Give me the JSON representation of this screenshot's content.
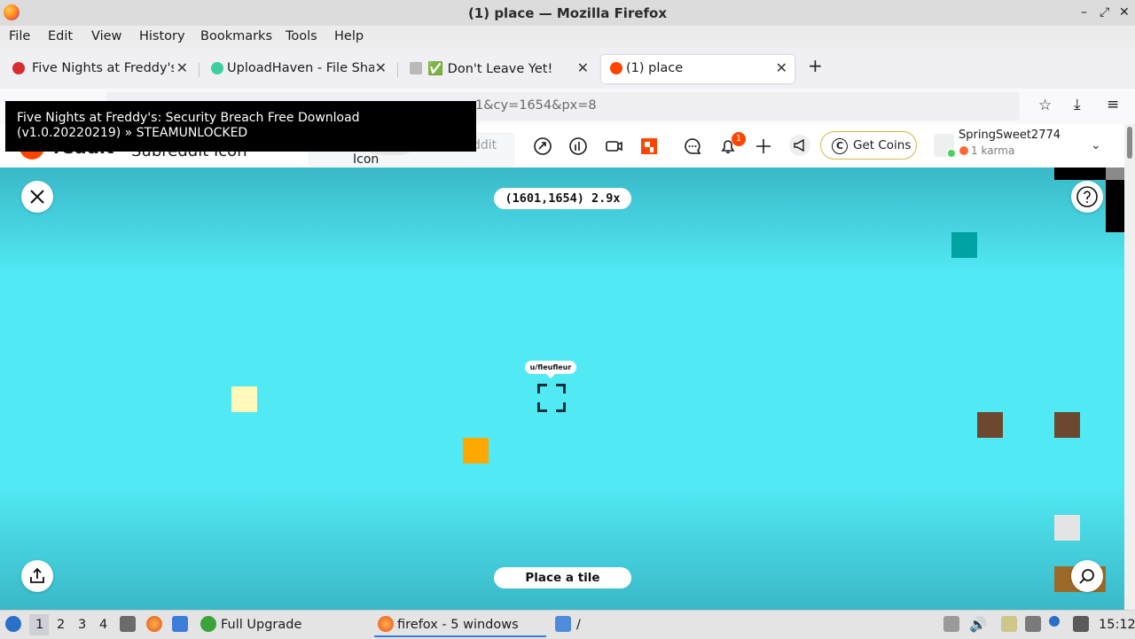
{
  "window": {
    "title": "(1) place — Mozilla Firefox",
    "controls": {
      "minimize": "–",
      "restore": "⤢",
      "close": "✕"
    }
  },
  "menu": {
    "items": [
      "File",
      "Edit",
      "View",
      "History",
      "Bookmarks",
      "Tools",
      "Help"
    ]
  },
  "tabs": [
    {
      "label": "Five Nights at Freddy's: ",
      "icon": "fnaf-icon",
      "active": false
    },
    {
      "label": "UploadHaven - File Sharin",
      "icon": "uploadhaven-cloud-icon",
      "active": false
    },
    {
      "label": "✅ Don't Leave Yet!",
      "icon": "generic-page-icon",
      "active": false
    },
    {
      "label": "(1) place",
      "icon": "reddit-icon",
      "active": true
    }
  ],
  "newtab": "+",
  "urlbar": {
    "visible_text": "1&cy=1654&px=8"
  },
  "tooltip": {
    "text": "Five Nights at Freddy's: Security Breach Free Download (v1.0.20220219) » STEAMUNLOCKED"
  },
  "reddit": {
    "wordmark": "reddit",
    "subreddit_label": "Subreddit Icon",
    "search_placeholder": "ddit",
    "icon_label": "Icon",
    "coins_label": "Get Coins",
    "notification_count": "1",
    "username": "SpringSweet2774",
    "karma": "1 karma"
  },
  "place": {
    "coords": "(1601,1654) 2.9x",
    "user_tag": "u/fleufleur",
    "place_tile_label": "Place a tile",
    "canvas_color": "#51e9f4"
  },
  "taskbar": {
    "workspaces": [
      "1",
      "2",
      "3",
      "4"
    ],
    "full_upgrade": "Full Upgrade",
    "firefox_windows": "firefox - 5 windows",
    "folder_path": "/",
    "clock": "15:12"
  }
}
